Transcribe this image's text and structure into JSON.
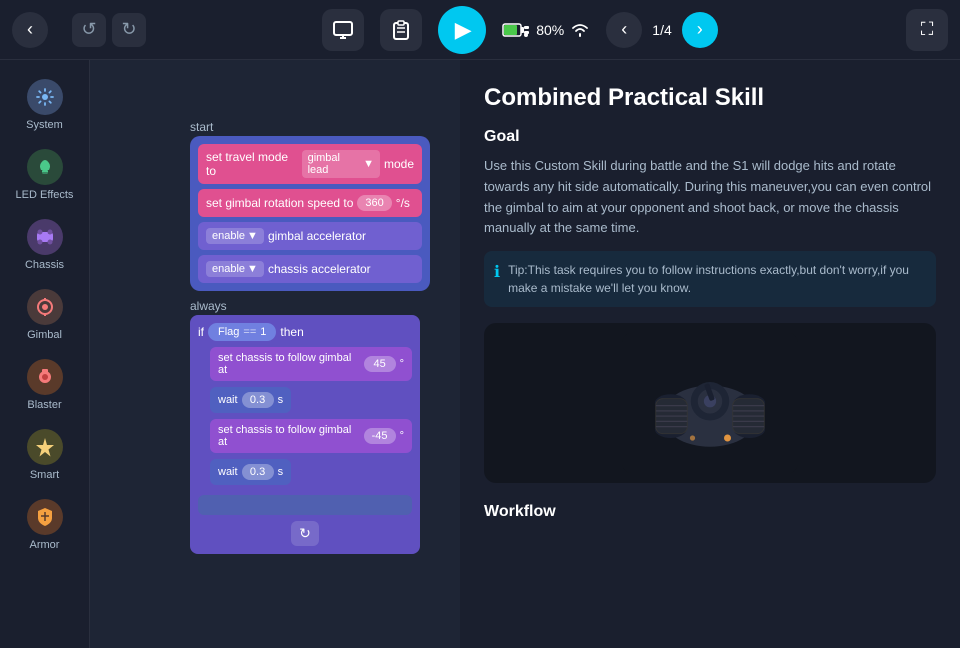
{
  "topbar": {
    "back_icon": "‹",
    "undo_icon": "↺",
    "redo_icon": "↻",
    "monitor_icon": "▭",
    "clipboard_icon": "📋",
    "play_icon": "▶",
    "battery_percent": "80%",
    "wifi_icon": "wifi",
    "prev_icon": "‹",
    "next_icon": "›",
    "page_current": "1",
    "page_total": "4",
    "page_separator": "/",
    "fullscreen_icon": "⛶"
  },
  "sidebar": {
    "items": [
      {
        "id": "system",
        "label": "System",
        "icon": "⚙"
      },
      {
        "id": "led-effects",
        "label": "LED Effects",
        "icon": "💡"
      },
      {
        "id": "chassis",
        "label": "Chassis",
        "icon": "🔷"
      },
      {
        "id": "gimbal",
        "label": "Gimbal",
        "icon": "🎯"
      },
      {
        "id": "blaster",
        "label": "Blaster",
        "icon": "🔴"
      },
      {
        "id": "smart",
        "label": "Smart",
        "icon": "✦"
      },
      {
        "id": "armor",
        "label": "Armor",
        "icon": "🛡"
      }
    ]
  },
  "blocks": {
    "start_label": "start",
    "travel_mode": "set travel mode to",
    "gimbal_lead": "gimbal lead",
    "mode": "mode",
    "rotation_speed": "set gimbal rotation speed to",
    "rotation_value": "360",
    "rotation_unit": "°/s",
    "enable1": "enable",
    "gimbal_accel": "gimbal accelerator",
    "enable2": "enable",
    "chassis_accel": "chassis accelerator",
    "always_label": "always",
    "if_label": "if",
    "flag_label": "Flag",
    "eq_label": "==",
    "flag_value": "1",
    "then_label": "then",
    "follow1": "set chassis to follow gimbal at",
    "follow1_value": "45",
    "follow1_unit": "°",
    "wait1": "wait",
    "wait1_value": "0.3",
    "wait1_unit": "s",
    "follow2": "set chassis to follow gimbal at",
    "follow2_value": "-45",
    "follow2_unit": "°",
    "wait2": "wait",
    "wait2_value": "0.3",
    "wait2_unit": "s"
  },
  "right_panel": {
    "title": "Combined Practical Skill",
    "goal_heading": "Goal",
    "goal_text": "Use this Custom Skill during battle and the S1 will dodge hits and rotate towards any hit side automatically. During this maneuver,you can even control the gimbal to aim at your opponent and shoot back, or move the chassis manually at the same time.",
    "tip_icon": "ℹ",
    "tip_text": "Tip:This task requires you to follow instructions exactly,but don't worry,if you make a mistake we'll let you know.",
    "workflow_heading": "Workflow"
  }
}
